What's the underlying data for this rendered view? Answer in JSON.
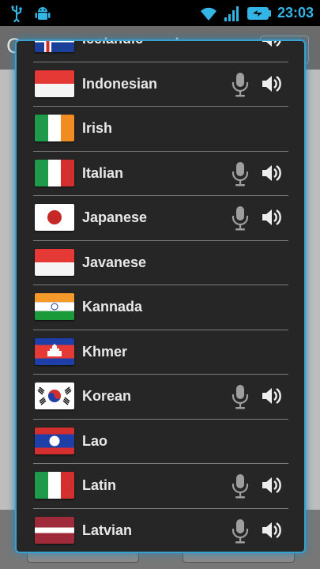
{
  "status_bar": {
    "time": "23:03",
    "icons": [
      "usb-icon",
      "android-debug-icon",
      "wifi-icon",
      "signal-icon",
      "battery-icon"
    ]
  },
  "background_app": {
    "title": "Conversation mode"
  },
  "languages": [
    {
      "name": "Icelandic",
      "flag": "iceland",
      "mic": false,
      "speaker": true
    },
    {
      "name": "Indonesian",
      "flag": "indonesia",
      "mic": true,
      "speaker": true
    },
    {
      "name": "Irish",
      "flag": "ireland",
      "mic": false,
      "speaker": false
    },
    {
      "name": "Italian",
      "flag": "italy",
      "mic": true,
      "speaker": true
    },
    {
      "name": "Japanese",
      "flag": "japan",
      "mic": true,
      "speaker": true
    },
    {
      "name": "Javanese",
      "flag": "indonesia",
      "mic": false,
      "speaker": false
    },
    {
      "name": "Kannada",
      "flag": "india",
      "mic": false,
      "speaker": false
    },
    {
      "name": "Khmer",
      "flag": "cambodia",
      "mic": false,
      "speaker": false
    },
    {
      "name": "Korean",
      "flag": "korea",
      "mic": true,
      "speaker": true
    },
    {
      "name": "Lao",
      "flag": "laos",
      "mic": false,
      "speaker": false
    },
    {
      "name": "Latin",
      "flag": "italy",
      "mic": true,
      "speaker": true
    },
    {
      "name": "Latvian",
      "flag": "latvia",
      "mic": true,
      "speaker": true
    }
  ],
  "colors": {
    "accent": "#33b5e5",
    "dialog_border": "#3aa0d0",
    "dialog_bg": "#262626"
  }
}
